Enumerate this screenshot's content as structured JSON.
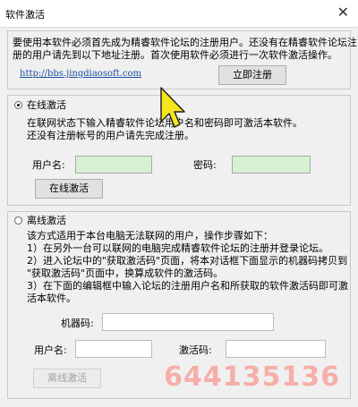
{
  "window": {
    "title": "软件激活",
    "close_glyph": "✕"
  },
  "intro": {
    "lines": [
      "要使用本软件必须首先成为精睿软件论坛的注册用户。还没有在精睿软件论坛注",
      "册的用户请先到以下地址注册。首次使用软件必须进行一次软件激活操作。"
    ],
    "url": "http://bbs.jingdiaosoft.com",
    "register_button": "立即注册"
  },
  "online": {
    "label": "在线激活",
    "selected": true,
    "lines": [
      "在联网状态下输入精睿软件论坛用户名和密码即可激活本软件。",
      "还没有注册帐号的用户请先完成注册。"
    ],
    "username_label": "用户名:",
    "password_label": "密码:",
    "button": "在线激活"
  },
  "offline": {
    "label": "离线激活",
    "selected": false,
    "lines": [
      "该方式适用于本台电脑无法联网的用户，操作步骤如下：",
      "1）在另外一台可以联网的电脑完成精睿软件论坛的注册并登录论坛。",
      "2）进入论坛中的\"获取激活码\"页面，将本对话框下面显示的机器码拷贝到",
      "\"获取激活码\"页面中，换算成软件的激活码。",
      "3）在下面的编辑框中输入论坛的注册用户名和所获取的软件激活码即可激",
      "活本软件。"
    ],
    "machine_code_label": "机器码:",
    "username_label": "用户名:",
    "activation_code_label": "激活码:",
    "button": "离线激活"
  },
  "watermark": "644135136"
}
